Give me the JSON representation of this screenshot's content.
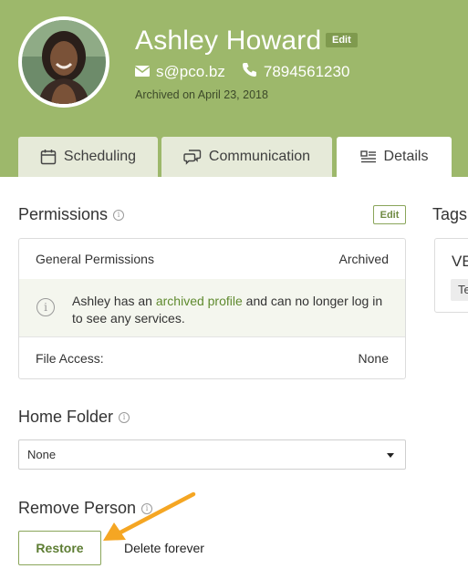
{
  "profile": {
    "name": "Ashley Howard",
    "edit_label": "Edit",
    "email": "s@pco.bz",
    "phone": "7894561230",
    "archived_note": "Archived on April 23, 2018"
  },
  "tabs": [
    {
      "label": "Scheduling",
      "icon": "calendar-icon",
      "active": false
    },
    {
      "label": "Communication",
      "icon": "chat-bubbles-icon",
      "active": false
    },
    {
      "label": "Details",
      "icon": "details-list-icon",
      "active": true
    }
  ],
  "permissions": {
    "title": "Permissions",
    "edit_label": "Edit",
    "general_label": "General Permissions",
    "general_value": "Archived",
    "notice_prefix": "Ashley has an ",
    "notice_link": "archived profile",
    "notice_suffix": " and can no longer log in to see any services.",
    "file_access_label": "File Access:",
    "file_access_value": "None"
  },
  "home_folder": {
    "title": "Home Folder",
    "selected": "None"
  },
  "remove_person": {
    "title": "Remove Person",
    "restore_label": "Restore",
    "delete_label": "Delete forever"
  },
  "tags": {
    "title": "Tags",
    "heading": "VE",
    "chip": "Te"
  },
  "colors": {
    "header_bg": "#9db86b",
    "tab_inactive": "#e6ead9",
    "accent": "#6f8a42",
    "annotation_arrow": "#f5a623"
  }
}
